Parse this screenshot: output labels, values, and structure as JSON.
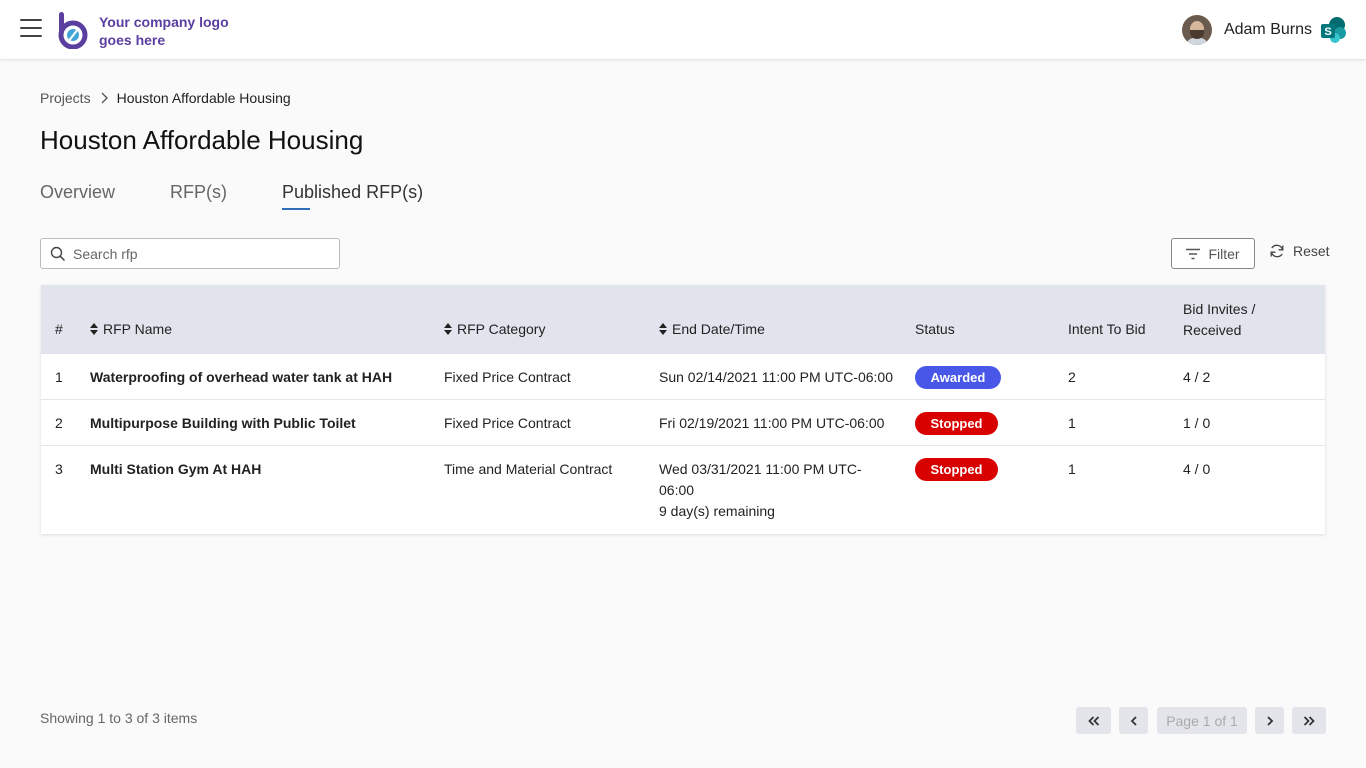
{
  "header": {
    "logo_text": "Your company logo goes here",
    "user_name": "Adam Burns"
  },
  "breadcrumb": {
    "parent": "Projects",
    "current": "Houston Affordable Housing"
  },
  "page_title": "Houston Affordable Housing",
  "tabs": [
    {
      "label": "Overview",
      "active": false
    },
    {
      "label": "RFP(s)",
      "active": false
    },
    {
      "label": "Published RFP(s)",
      "active": true
    }
  ],
  "toolbar": {
    "search_placeholder": "Search rfp",
    "filter_label": "Filter",
    "reset_label": "Reset"
  },
  "table": {
    "columns": {
      "num": "#",
      "name": "RFP Name",
      "category": "RFP Category",
      "end": "End Date/Time",
      "status": "Status",
      "intent": "Intent To Bid",
      "invites": "Bid Invites / Received"
    },
    "rows": [
      {
        "num": "1",
        "name": "Waterproofing of overhead water tank at HAH",
        "category": "Fixed Price Contract",
        "end_line1": "Sun 02/14/2021 11:00 PM UTC-06:00",
        "end_line2": "",
        "end_line3": "",
        "status": "Awarded",
        "intent": "2",
        "invites": "4 / 2"
      },
      {
        "num": "2",
        "name": "Multipurpose Building with Public Toilet",
        "category": "Fixed Price Contract",
        "end_line1": "Fri 02/19/2021 11:00 PM UTC-06:00",
        "end_line2": "",
        "end_line3": "",
        "status": "Stopped",
        "intent": "1",
        "invites": "1 / 0"
      },
      {
        "num": "3",
        "name": "Multi Station Gym At HAH",
        "category": "Time and Material Contract",
        "end_line1": "Wed 03/31/2021 11:00 PM UTC-",
        "end_line2": "06:00",
        "end_line3": "9 day(s) remaining",
        "status": "Stopped",
        "intent": "1",
        "invites": "4 / 0"
      }
    ]
  },
  "footer": {
    "showing": "Showing 1 to 3 of 3 items",
    "page_label": "Page 1 of 1"
  },
  "colors": {
    "awarded": "#4857e8",
    "stopped": "#d90000",
    "brand": "#5b3fa0"
  }
}
